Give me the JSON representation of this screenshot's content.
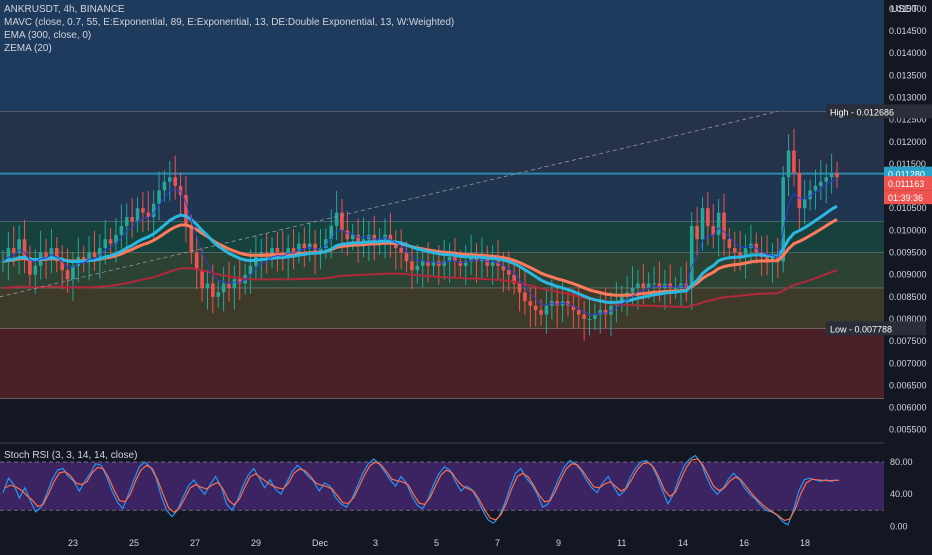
{
  "header": {
    "symbol_line": "ANKRUSDT, 4h, BINANCE",
    "indicators": [
      "MAVC (close, 0.7, 55, E:Exponential, 89, E:Exponential, 13, DE:Double Exponential, 13, W:Weighted)",
      "EMA (300, close, 0)",
      "ZEMA (20)"
    ],
    "currency": "USDT",
    "rsi_label": "Stoch RSI (3, 3, 14, 14, close)"
  },
  "chart_data": [
    {
      "type": "candlestick",
      "title": "ANKRUSDT, 4h, BINANCE",
      "y_ticks": [
        "0.015000",
        "0.014500",
        "0.014000",
        "0.013500",
        "0.013000",
        "0.012500",
        "0.012000",
        "0.011500",
        "0.011000",
        "0.010500",
        "0.010000",
        "0.009500",
        "0.009000",
        "0.008500",
        "0.008000",
        "0.007500",
        "0.007000",
        "0.006500",
        "0.006000",
        "0.005500"
      ],
      "x_ticks": [
        "23",
        "25",
        "27",
        "29",
        "Dec",
        "3",
        "5",
        "7",
        "9",
        "11",
        "14",
        "16",
        "18"
      ],
      "ylim": [
        0.0052,
        0.0152
      ],
      "price_labels": {
        "high": "High - 0.012686",
        "line": "0.011280",
        "current": "0.011163",
        "countdown": "01:39:36",
        "low": "Low - 0.007788"
      },
      "levels": [
        0.012686,
        0.01128,
        0.0102,
        0.0095,
        0.0087,
        0.007788,
        0.0062
      ],
      "closes": [
        0.0093,
        0.0096,
        0.0095,
        0.0098,
        0.0094,
        0.009,
        0.0092,
        0.0095,
        0.0094,
        0.0096,
        0.0093,
        0.0091,
        0.0089,
        0.0092,
        0.0094,
        0.0093,
        0.0095,
        0.0094,
        0.0096,
        0.0098,
        0.0097,
        0.0099,
        0.0101,
        0.0103,
        0.0102,
        0.0105,
        0.0104,
        0.0103,
        0.0106,
        0.0109,
        0.0111,
        0.0112,
        0.011,
        0.0108,
        0.0101,
        0.0095,
        0.0091,
        0.0087,
        0.0088,
        0.0085,
        0.0086,
        0.0088,
        0.0087,
        0.0089,
        0.0088,
        0.009,
        0.0092,
        0.0094,
        0.0095,
        0.0094,
        0.0096,
        0.0095,
        0.0094,
        0.0096,
        0.0095,
        0.0097,
        0.0096,
        0.0097,
        0.0095,
        0.0096,
        0.0098,
        0.0101,
        0.0104,
        0.01,
        0.0098,
        0.0099,
        0.0097,
        0.0098,
        0.0099,
        0.0097,
        0.0098,
        0.0099,
        0.0097,
        0.0096,
        0.0095,
        0.0093,
        0.0091,
        0.0092,
        0.0093,
        0.0092,
        0.0093,
        0.0092,
        0.0093,
        0.0094,
        0.0093,
        0.0092,
        0.0093,
        0.0094,
        0.0093,
        0.0094,
        0.0092,
        0.0093,
        0.0092,
        0.0091,
        0.009,
        0.0088,
        0.0086,
        0.0084,
        0.0083,
        0.0082,
        0.0081,
        0.0083,
        0.0084,
        0.0083,
        0.0084,
        0.0083,
        0.0082,
        0.0081,
        0.008,
        0.008,
        0.0081,
        0.0082,
        0.0081,
        0.0083,
        0.0084,
        0.0085,
        0.0086,
        0.0087,
        0.0088,
        0.0087,
        0.0088,
        0.0088,
        0.0087,
        0.0088,
        0.0087,
        0.0087,
        0.0088,
        0.0087,
        0.0101,
        0.0098,
        0.0105,
        0.0101,
        0.0099,
        0.0104,
        0.0098,
        0.0096,
        0.0095,
        0.0094,
        0.0096,
        0.0097,
        0.0095,
        0.0094,
        0.0093,
        0.0094,
        0.0093,
        0.0112,
        0.0118,
        0.0113,
        0.0105,
        0.0107,
        0.0109,
        0.011,
        0.0111,
        0.0112,
        0.0113,
        0.0112
      ]
    },
    {
      "type": "line",
      "title": "Stoch RSI (3, 3, 14, 14, close)",
      "y_ticks": [
        "80.00",
        "40.00",
        "0.00"
      ],
      "ylim": [
        -12,
        100
      ],
      "bands": [
        80,
        20
      ],
      "k": [
        42,
        60,
        52,
        35,
        48,
        32,
        18,
        24,
        40,
        58,
        70,
        72,
        62,
        56,
        44,
        56,
        66,
        78,
        76,
        62,
        44,
        30,
        22,
        40,
        58,
        74,
        80,
        74,
        62,
        38,
        20,
        12,
        20,
        36,
        50,
        58,
        48,
        40,
        52,
        62,
        50,
        28,
        20,
        32,
        50,
        64,
        72,
        60,
        48,
        58,
        46,
        40,
        54,
        68,
        76,
        70,
        62,
        56,
        44,
        54,
        50,
        36,
        28,
        24,
        34,
        50,
        66,
        78,
        84,
        78,
        68,
        58,
        50,
        62,
        54,
        38,
        26,
        22,
        34,
        52,
        66,
        74,
        70,
        56,
        44,
        50,
        46,
        34,
        20,
        8,
        4,
        12,
        28,
        48,
        66,
        72,
        60,
        52,
        40,
        24,
        28,
        44,
        60,
        74,
        82,
        78,
        70,
        58,
        48,
        42,
        54,
        62,
        50,
        38,
        44,
        60,
        72,
        80,
        82,
        76,
        62,
        44,
        28,
        40,
        60,
        76,
        84,
        88,
        80,
        62,
        48,
        40,
        46,
        58,
        66,
        60,
        48,
        40,
        34,
        26,
        20,
        18,
        14,
        6,
        2,
        20,
        44,
        58,
        60,
        58,
        56,
        58,
        56,
        58
      ]
    }
  ]
}
